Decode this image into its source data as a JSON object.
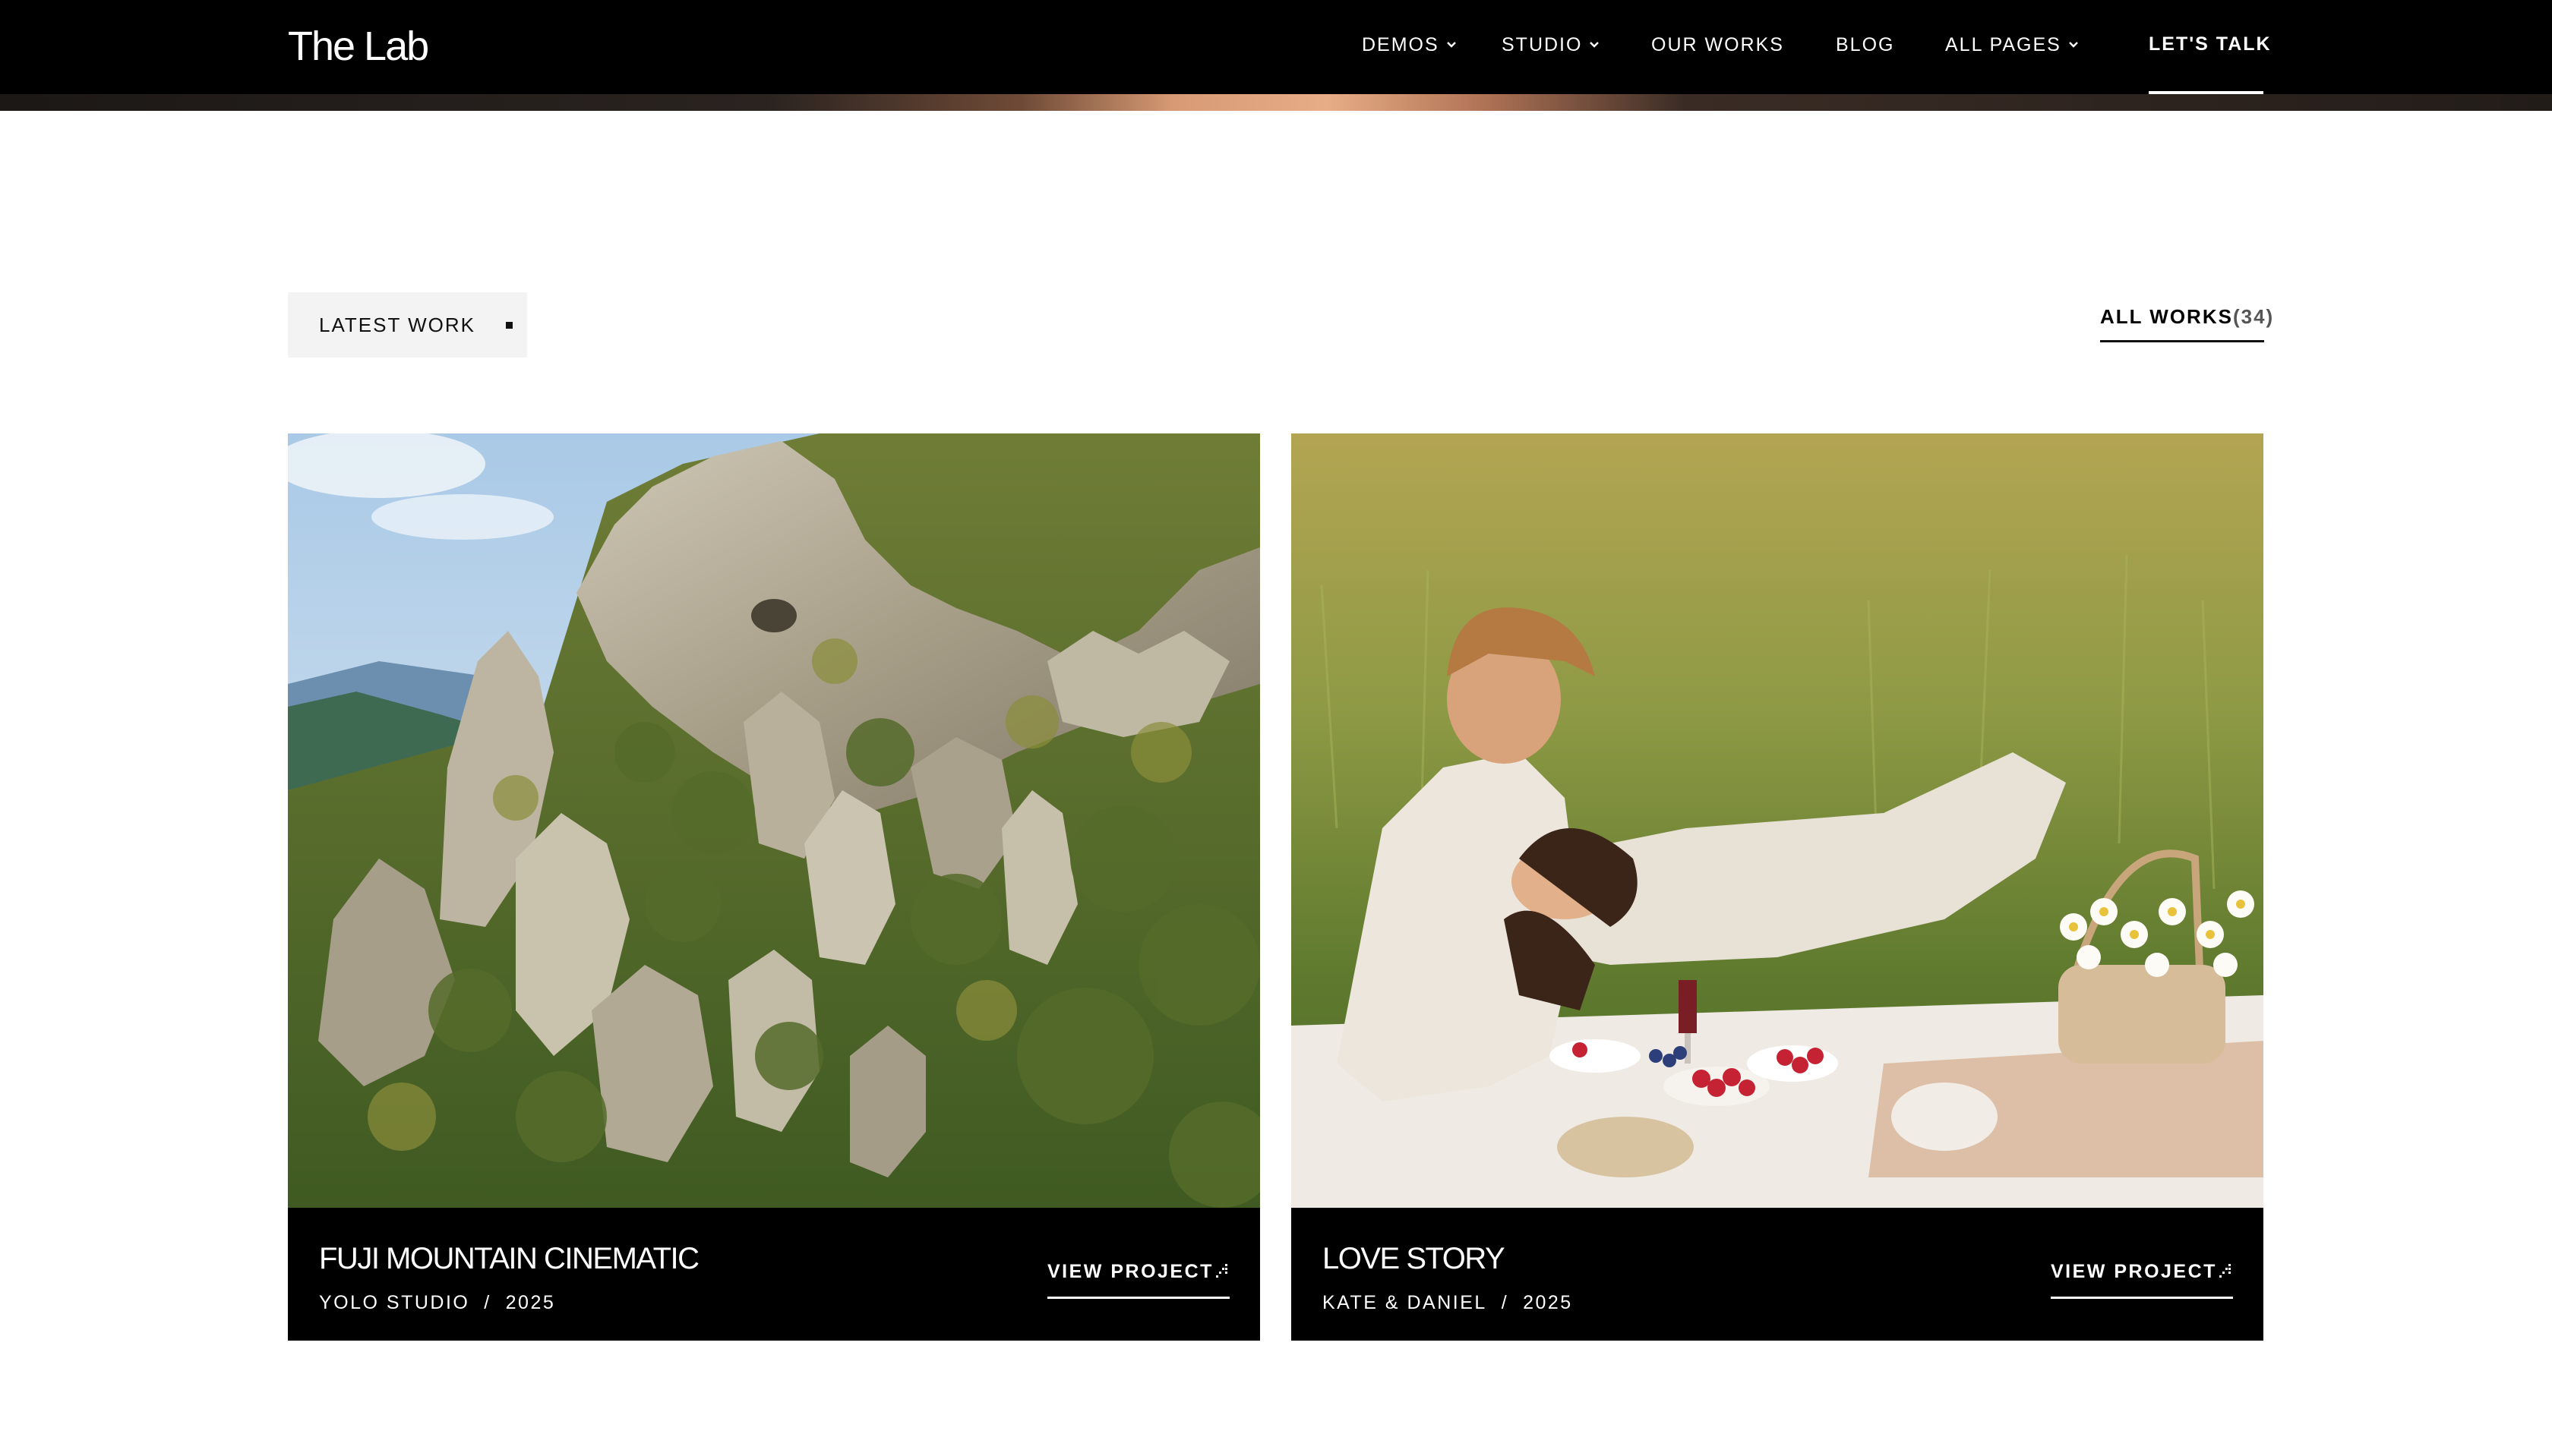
{
  "header": {
    "logo": "The Lab",
    "nav": [
      {
        "label": "DEMOS",
        "has_dropdown": true
      },
      {
        "label": "STUDIO",
        "has_dropdown": true
      },
      {
        "label": "OUR WORKS",
        "has_dropdown": false
      },
      {
        "label": "BLOG",
        "has_dropdown": false
      },
      {
        "label": "ALL PAGES",
        "has_dropdown": true
      }
    ],
    "cta": "LET'S TALK"
  },
  "section": {
    "tag": "LATEST WORK",
    "all_works": {
      "label": "ALL WORKS",
      "count": "(34)"
    }
  },
  "projects": [
    {
      "title": "FUJI MOUNTAIN CINEMATIC",
      "client": "YOLO STUDIO",
      "separator": "/",
      "year": "2025",
      "action": "VIEW PROJECT",
      "image": "rocky mountain ridge"
    },
    {
      "title": "LOVE STORY",
      "client": "KATE & DANIEL",
      "separator": "/",
      "year": "2025",
      "action": "VIEW PROJECT",
      "image": "couple picnic in meadow"
    }
  ],
  "colors": {
    "header_bg": "#000000",
    "page_bg": "#ffffff",
    "pill_bg": "#f3f3f3",
    "card_info_bg": "#000000"
  }
}
